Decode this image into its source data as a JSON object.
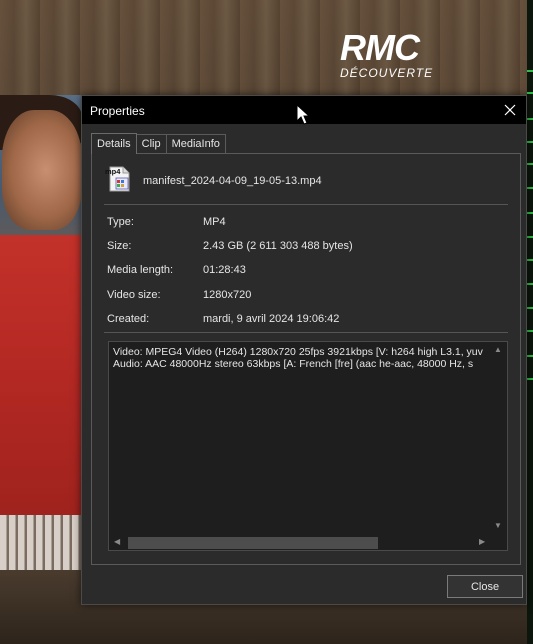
{
  "channel_logo": {
    "main": "RMC",
    "sub": "DÉCOUVERTE"
  },
  "dialog": {
    "title": "Properties",
    "tabs": [
      {
        "label": "Details",
        "active": true
      },
      {
        "label": "Clip",
        "active": false
      },
      {
        "label": "MediaInfo",
        "active": false
      }
    ],
    "file": {
      "icon_badge": "mp4",
      "name": "manifest_2024-04-09_19-05-13.mp4"
    },
    "properties": {
      "type_label": "Type:",
      "type_value": "MP4",
      "size_label": "Size:",
      "size_value": "2.43 GB (2 611 303 488 bytes)",
      "length_label": "Media length:",
      "length_value": "01:28:43",
      "video_size_label": "Video size:",
      "video_size_value": "1280x720",
      "created_label": "Created:",
      "created_value": "mardi, 9 avril 2024 19:06:42"
    },
    "stream_info": {
      "video_line": "Video: MPEG4 Video (H264) 1280x720 25fps 3921kbps [V: h264 high L3.1, yuv",
      "audio_line": "Audio: AAC 48000Hz stereo 63kbps [A: French [fre] (aac he-aac, 48000 Hz, s"
    },
    "close_button_label": "Close"
  },
  "colors": {
    "titlebar": "#000000",
    "dialog_bg": "#2b2b2b",
    "info_bg": "#1e1e1e",
    "text": "#e6e6e6",
    "shirt_red": "#c3312a"
  }
}
